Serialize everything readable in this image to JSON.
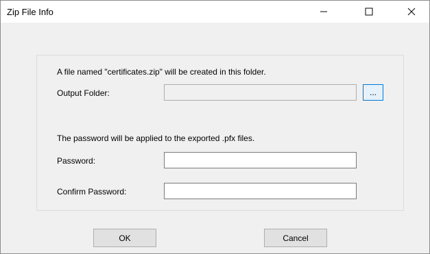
{
  "window": {
    "title": "Zip File Info"
  },
  "folder_section": {
    "info_text": "A file named \"certificates.zip\" will be created in this folder.",
    "output_folder_label": "Output Folder:",
    "output_folder_value": "",
    "browse_label": "..."
  },
  "password_section": {
    "info_text": "The password will be applied to the exported .pfx files.",
    "password_label": "Password:",
    "password_value": "",
    "confirm_label": "Confirm Password:",
    "confirm_value": ""
  },
  "buttons": {
    "ok": "OK",
    "cancel": "Cancel"
  },
  "icons": {
    "minimize": "minimize-icon",
    "maximize": "maximize-icon",
    "close": "close-icon"
  },
  "colors": {
    "accent": "#0078d7",
    "window_bg": "#f0f0f0",
    "titlebar_bg": "#ffffff"
  }
}
